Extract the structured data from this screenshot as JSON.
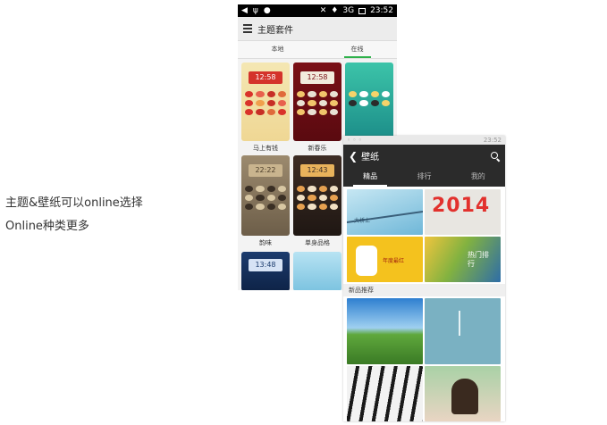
{
  "caption": {
    "line1": "主题&壁纸可以online选择",
    "line2": "Online种类更多"
  },
  "phone1": {
    "status": {
      "time": "23:52",
      "signal": "3G"
    },
    "header": {
      "title": "主题套件"
    },
    "tabs": [
      {
        "label": "本地"
      },
      {
        "label": "在线",
        "active": true
      }
    ],
    "themes": [
      {
        "label": "马上有钱",
        "clock": "12:58"
      },
      {
        "label": "新春乐",
        "clock": "12:58"
      },
      {
        "label": ""
      },
      {
        "label": "韵味",
        "clock": "22:22"
      },
      {
        "label": "单身品格",
        "clock": "12:43"
      },
      {
        "label": "",
        "clock": "13:48"
      },
      {
        "label": ""
      }
    ]
  },
  "phone2": {
    "status": {
      "time": "23:52"
    },
    "header": {
      "title": "壁纸"
    },
    "tabs": [
      {
        "label": "精品",
        "active": true
      },
      {
        "label": "排行"
      },
      {
        "label": "我的"
      }
    ],
    "featured": [
      {
        "text": "大桥上"
      },
      {
        "text": "2014"
      },
      {
        "text": "年度最红"
      },
      {
        "text": "热门排行"
      }
    ],
    "section": "新品推荐"
  },
  "colors": {
    "accent_green": "#2eb14a",
    "header_dark": "#2b2b2b"
  }
}
